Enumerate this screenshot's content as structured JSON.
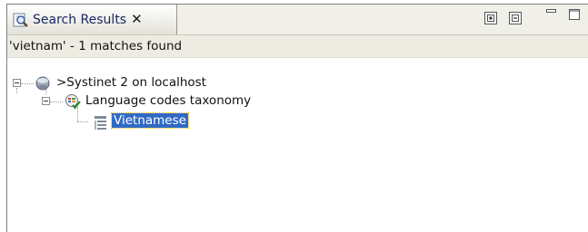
{
  "view": {
    "tab": {
      "title": "Search Results",
      "close_glyph": "✕"
    },
    "toolbar": {
      "expand_all_icon": "expand-all-icon",
      "collapse_all_icon": "collapse-all-icon",
      "minimize_icon": "minimize-icon",
      "maximize_icon": "maximize-icon"
    },
    "status": "'vietnam' - 1 matches found"
  },
  "tree": {
    "nodes": [
      {
        "label": ">Systinet 2 on localhost",
        "icon": "registry-server-icon",
        "expanded": true,
        "level": 0
      },
      {
        "label": "Language codes taxonomy",
        "icon": "taxonomy-checked-icon",
        "expanded": true,
        "level": 1
      },
      {
        "label": "Vietnamese",
        "icon": "category-list-icon",
        "selected": true,
        "level": 2
      }
    ]
  },
  "colors": {
    "selection_bg": "#316ac5",
    "selection_focus": "#f2c000",
    "tab_text": "#1a2a63"
  }
}
